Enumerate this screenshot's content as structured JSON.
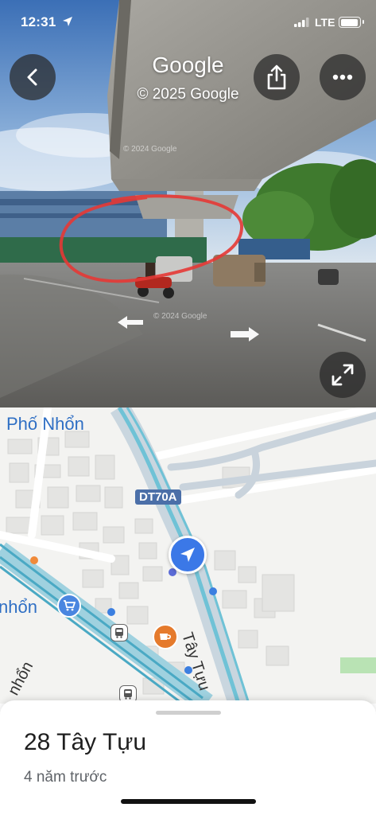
{
  "status": {
    "time": "12:31",
    "network": "LTE",
    "icons": [
      "location-arrow-icon",
      "signal-bars-icon",
      "battery-icon"
    ]
  },
  "street_view": {
    "title": "Google",
    "copyright": "© 2025 Google",
    "watermark_top": "© 2024 Google",
    "watermark_mid": "© 2024 Google",
    "buttons": {
      "back": "chevron-left-icon",
      "share": "share-icon",
      "more": "more-dots-icon",
      "expand": "expand-icon"
    },
    "colors": {
      "annotation_circle": "#e53935",
      "button_bg": "#282828"
    }
  },
  "map": {
    "labels": {
      "area_top": "Phố Nhổn",
      "area_left": "nhổn",
      "road_shield": "DT70A",
      "road_main": "Tây Tựu",
      "road_left": "nhổn"
    },
    "markers": {
      "navigation": "navigation-arrow-icon",
      "shop": "shopping-cart-icon",
      "cafe": "coffee-cup-icon",
      "bus": "bus-icon"
    },
    "colors": {
      "accent": "#3b78e7",
      "road_blue": "#6fc2d6",
      "shield": "#4b6fa8",
      "label": "#2f6fc4"
    }
  },
  "place": {
    "name": "28 Tây Tựu",
    "time_ago": "4 năm trước"
  }
}
